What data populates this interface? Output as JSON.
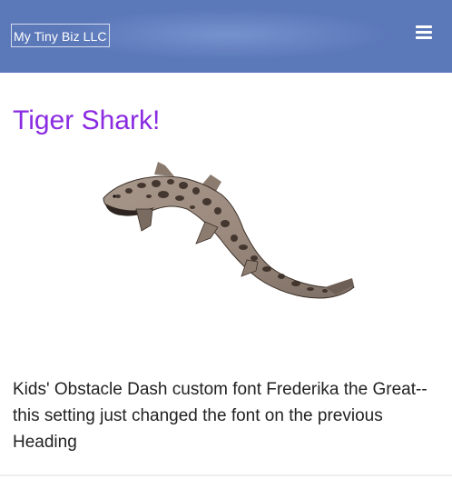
{
  "navbar": {
    "brand": "My Tiny Biz LLC",
    "menu_icon": "hamburger-menu-icon",
    "background_color": "#6681c1"
  },
  "main": {
    "heading": "Tiger Shark!",
    "heading_color": "#8a2be2",
    "image_subject": "leopard-spotted shark",
    "paragraph": "Kids' Obstacle Dash custom font Frederika the Great--this setting just changed the font on the previous Heading"
  }
}
